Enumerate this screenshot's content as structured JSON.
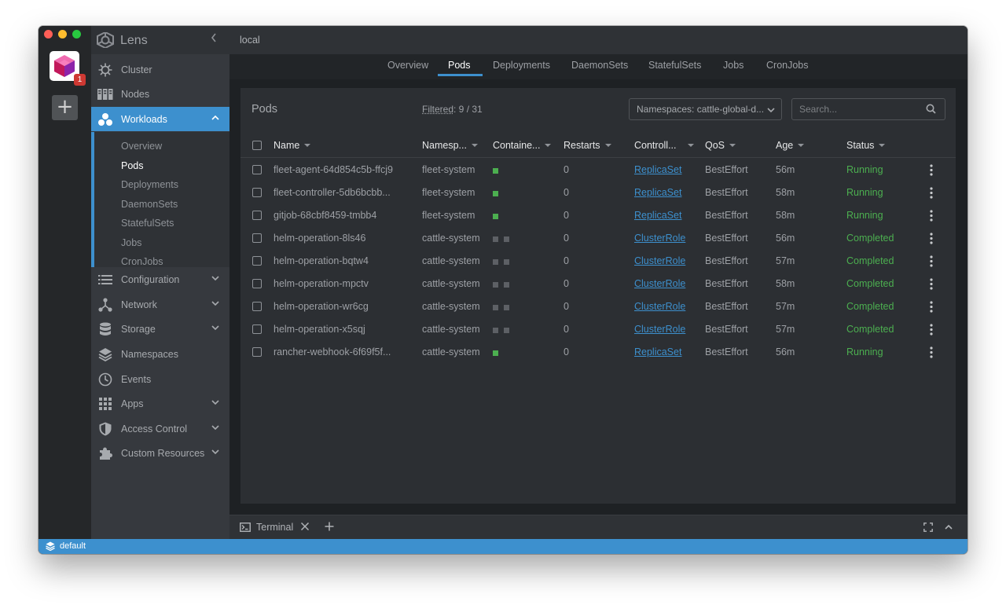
{
  "app": {
    "name": "Lens",
    "cluster_badge": "1"
  },
  "sidebar": {
    "items": [
      {
        "label": "Cluster",
        "icon": "helm-icon"
      },
      {
        "label": "Nodes",
        "icon": "nodes-icon"
      },
      {
        "label": "Workloads",
        "icon": "workloads-icon",
        "active": true
      },
      {
        "label": "Configuration",
        "icon": "list-icon"
      },
      {
        "label": "Network",
        "icon": "network-icon"
      },
      {
        "label": "Storage",
        "icon": "database-icon"
      },
      {
        "label": "Namespaces",
        "icon": "layers-icon"
      },
      {
        "label": "Events",
        "icon": "clock-icon"
      },
      {
        "label": "Apps",
        "icon": "grid-icon"
      },
      {
        "label": "Access Control",
        "icon": "shield-icon"
      },
      {
        "label": "Custom Resources",
        "icon": "puzzle-icon"
      }
    ],
    "workloads_sub": [
      "Overview",
      "Pods",
      "Deployments",
      "DaemonSets",
      "StatefulSets",
      "Jobs",
      "CronJobs"
    ]
  },
  "topbar": {
    "title": "local"
  },
  "tabs": [
    "Overview",
    "Pods",
    "Deployments",
    "DaemonSets",
    "StatefulSets",
    "Jobs",
    "CronJobs"
  ],
  "content": {
    "title": "Pods",
    "filtered_label": "Filtered",
    "filtered_value": ": 9 / 31",
    "namespace_select": "Namespaces: cattle-global-d...",
    "search_placeholder": "Search..."
  },
  "table": {
    "columns": [
      "Name",
      "Namesp...",
      "Containe...",
      "Restarts",
      "Controll...",
      "QoS",
      "Age",
      "Status"
    ],
    "rows": [
      {
        "name": "fleet-agent-64d854c5b-ffcj9",
        "namespace": "fleet-system",
        "containers": [
          "green"
        ],
        "restarts": "0",
        "controller": "ReplicaSet",
        "qos": "BestEffort",
        "age": "56m",
        "status": "Running"
      },
      {
        "name": "fleet-controller-5db6bcbb...",
        "namespace": "fleet-system",
        "containers": [
          "green"
        ],
        "restarts": "0",
        "controller": "ReplicaSet",
        "qos": "BestEffort",
        "age": "58m",
        "status": "Running"
      },
      {
        "name": "gitjob-68cbf8459-tmbb4",
        "namespace": "fleet-system",
        "containers": [
          "green"
        ],
        "restarts": "0",
        "controller": "ReplicaSet",
        "qos": "BestEffort",
        "age": "58m",
        "status": "Running"
      },
      {
        "name": "helm-operation-8ls46",
        "namespace": "cattle-system",
        "containers": [
          "gray",
          "gray"
        ],
        "restarts": "0",
        "controller": "ClusterRole",
        "qos": "BestEffort",
        "age": "56m",
        "status": "Completed"
      },
      {
        "name": "helm-operation-bqtw4",
        "namespace": "cattle-system",
        "containers": [
          "gray",
          "gray"
        ],
        "restarts": "0",
        "controller": "ClusterRole",
        "qos": "BestEffort",
        "age": "57m",
        "status": "Completed"
      },
      {
        "name": "helm-operation-mpctv",
        "namespace": "cattle-system",
        "containers": [
          "gray",
          "gray"
        ],
        "restarts": "0",
        "controller": "ClusterRole",
        "qos": "BestEffort",
        "age": "58m",
        "status": "Completed"
      },
      {
        "name": "helm-operation-wr6cg",
        "namespace": "cattle-system",
        "containers": [
          "gray",
          "gray"
        ],
        "restarts": "0",
        "controller": "ClusterRole",
        "qos": "BestEffort",
        "age": "57m",
        "status": "Completed"
      },
      {
        "name": "helm-operation-x5sqj",
        "namespace": "cattle-system",
        "containers": [
          "gray",
          "gray"
        ],
        "restarts": "0",
        "controller": "ClusterRole",
        "qos": "BestEffort",
        "age": "57m",
        "status": "Completed"
      },
      {
        "name": "rancher-webhook-6f69f5f...",
        "namespace": "cattle-system",
        "containers": [
          "green"
        ],
        "restarts": "0",
        "controller": "ReplicaSet",
        "qos": "BestEffort",
        "age": "56m",
        "status": "Running"
      }
    ]
  },
  "terminal": {
    "label": "Terminal"
  },
  "statusbar": {
    "text": "default"
  },
  "colors": {
    "accent": "#3d90ce",
    "running": "#4caf50",
    "container_idle": "#5d6065"
  }
}
